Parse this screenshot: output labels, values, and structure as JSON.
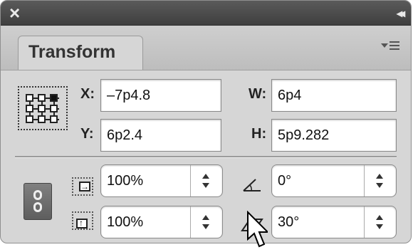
{
  "panel": {
    "close_glyph": "×",
    "collapse_glyph": "◂◂",
    "tab_label": "Transform",
    "menu_icon": "panel-menu-icon"
  },
  "position": {
    "x_label": "X:",
    "x_value": "–7p4.8",
    "y_label": "Y:",
    "y_value": "6p2.4",
    "w_label": "W:",
    "w_value": "6p4",
    "h_label": "H:",
    "h_value": "5p9.282"
  },
  "scale": {
    "scale_x_value": "100%",
    "scale_y_value": "100%",
    "constrain_icon": "chain-link-icon"
  },
  "rotation": {
    "rotate_value": "0°",
    "shear_value": "30°"
  }
}
